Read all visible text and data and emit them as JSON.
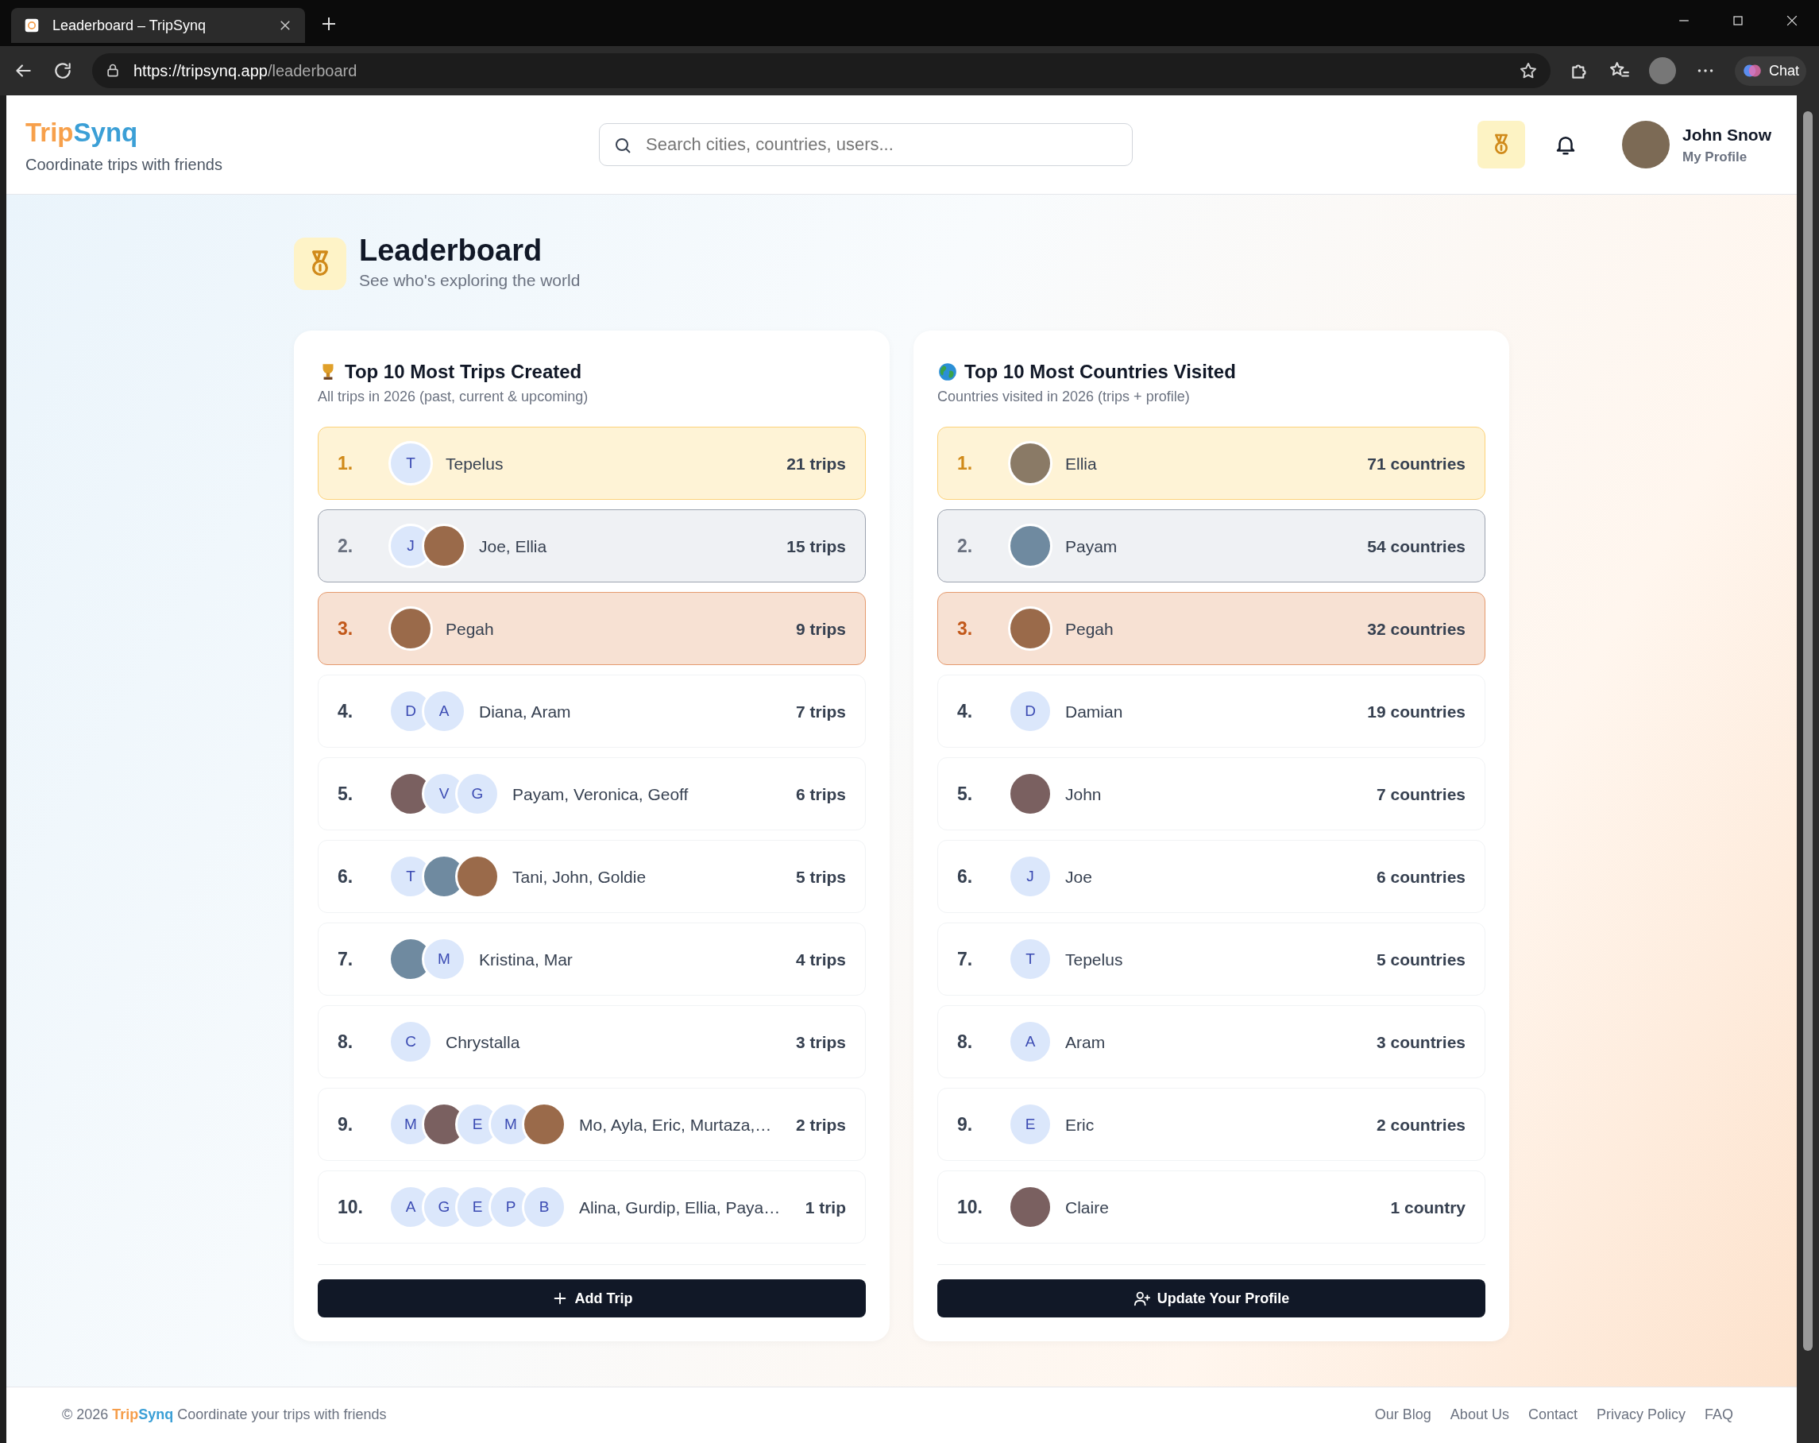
{
  "browser": {
    "tab_title": "Leaderboard – TripSynq",
    "url_host": "https://tripsynq.app",
    "url_path": "/leaderboard",
    "chat_label": "Chat"
  },
  "header": {
    "logo_left": "Trip",
    "logo_right": "Synq",
    "tagline": "Coordinate trips with friends",
    "search": {
      "placeholder": "Search cities, countries, users..."
    },
    "user": {
      "name": "John Snow",
      "link": "My Profile"
    }
  },
  "page": {
    "title": "Leaderboard",
    "subtitle": "See who's exploring the world"
  },
  "boards": [
    {
      "title": "Top 10 Most Trips Created",
      "subtitle": "All trips in 2026 (past, current & upcoming)",
      "button": {
        "label": "Add Trip"
      },
      "rows": [
        {
          "rank": "1.",
          "color": "#fef3d6",
          "avatars": [
            {
              "kind": "initial",
              "initial": "T"
            }
          ],
          "names": "Tepelus",
          "count": "21 trips"
        },
        {
          "rank": "2.",
          "color": "#eff1f4",
          "avatars": [
            {
              "kind": "initial",
              "initial": "J"
            },
            {
              "kind": "photo"
            }
          ],
          "names": "Joe, Ellia",
          "count": "15 trips"
        },
        {
          "rank": "3.",
          "color": "#f7e1d3",
          "avatars": [
            {
              "kind": "photo"
            }
          ],
          "names": "Pegah",
          "count": "9 trips"
        },
        {
          "rank": "4.",
          "avatars": [
            {
              "kind": "initial",
              "initial": "D"
            },
            {
              "kind": "initial",
              "initial": "A"
            }
          ],
          "names": "Diana, Aram",
          "count": "7 trips"
        },
        {
          "rank": "5.",
          "avatars": [
            {
              "kind": "photo"
            },
            {
              "kind": "initial",
              "initial": "V"
            },
            {
              "kind": "initial",
              "initial": "G"
            }
          ],
          "names": "Payam, Veronica, Geoff",
          "count": "6 trips"
        },
        {
          "rank": "6.",
          "avatars": [
            {
              "kind": "initial",
              "initial": "T"
            },
            {
              "kind": "photo"
            },
            {
              "kind": "photo"
            }
          ],
          "names": "Tani, John, Goldie",
          "count": "5 trips"
        },
        {
          "rank": "7.",
          "avatars": [
            {
              "kind": "photo"
            },
            {
              "kind": "initial",
              "initial": "M"
            }
          ],
          "names": "Kristina, Mar",
          "count": "4 trips"
        },
        {
          "rank": "8.",
          "avatars": [
            {
              "kind": "initial",
              "initial": "C"
            }
          ],
          "names": "Chrystalla",
          "count": "3 trips"
        },
        {
          "rank": "9.",
          "avatars": [
            {
              "kind": "initial",
              "initial": "M"
            },
            {
              "kind": "photo"
            },
            {
              "kind": "initial",
              "initial": "E"
            },
            {
              "kind": "initial",
              "initial": "M"
            },
            {
              "kind": "photo"
            }
          ],
          "names": "Mo, Ayla, Eric, Murtaza,…",
          "count": "2 trips"
        },
        {
          "rank": "10.",
          "avatars": [
            {
              "kind": "initial",
              "initial": "A"
            },
            {
              "kind": "initial",
              "initial": "G"
            },
            {
              "kind": "initial",
              "initial": "E"
            },
            {
              "kind": "initial",
              "initial": "P"
            },
            {
              "kind": "initial",
              "initial": "B"
            }
          ],
          "names": "Alina, Gurdip, Ellia, Paya…",
          "count": "1 trip"
        }
      ]
    },
    {
      "title": "Top 10 Most Countries Visited",
      "subtitle": "Countries visited in 2026 (trips + profile)",
      "button": {
        "label": "Update Your Profile"
      },
      "rows": [
        {
          "rank": "1.",
          "color": "#fef3d6",
          "avatars": [
            {
              "kind": "photo"
            }
          ],
          "names": "Ellia",
          "count": "71 countries"
        },
        {
          "rank": "2.",
          "color": "#eff1f4",
          "avatars": [
            {
              "kind": "photo"
            }
          ],
          "names": "Payam",
          "count": "54 countries"
        },
        {
          "rank": "3.",
          "color": "#f7e1d3",
          "avatars": [
            {
              "kind": "photo"
            }
          ],
          "names": "Pegah",
          "count": "32 countries"
        },
        {
          "rank": "4.",
          "avatars": [
            {
              "kind": "initial",
              "initial": "D"
            }
          ],
          "names": "Damian",
          "count": "19 countries"
        },
        {
          "rank": "5.",
          "avatars": [
            {
              "kind": "photo"
            }
          ],
          "names": "John",
          "count": "7 countries"
        },
        {
          "rank": "6.",
          "avatars": [
            {
              "kind": "initial",
              "initial": "J"
            }
          ],
          "names": "Joe",
          "count": "6 countries"
        },
        {
          "rank": "7.",
          "avatars": [
            {
              "kind": "initial",
              "initial": "T"
            }
          ],
          "names": "Tepelus",
          "count": "5 countries"
        },
        {
          "rank": "8.",
          "avatars": [
            {
              "kind": "initial",
              "initial": "A"
            }
          ],
          "names": "Aram",
          "count": "3 countries"
        },
        {
          "rank": "9.",
          "avatars": [
            {
              "kind": "initial",
              "initial": "E"
            }
          ],
          "names": "Eric",
          "count": "2 countries"
        },
        {
          "rank": "10.",
          "avatars": [
            {
              "kind": "photo"
            }
          ],
          "names": "Claire",
          "count": "1 country"
        }
      ]
    }
  ],
  "footer": {
    "copyright": "© 2026",
    "brand_left": "Trip",
    "brand_right": "Synq",
    "tagline": "Coordinate your trips with friends",
    "links": [
      "Our Blog",
      "About Us",
      "Contact",
      "Privacy Policy",
      "FAQ"
    ]
  }
}
